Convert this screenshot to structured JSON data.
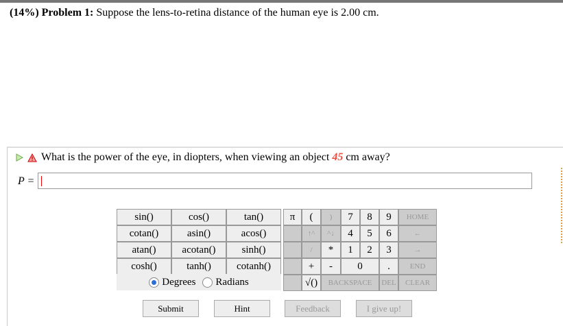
{
  "problem": {
    "percent": "(14%)",
    "label": "Problem 1:",
    "text": "Suppose the lens-to-retina distance of the human eye is 2.00 cm."
  },
  "question": {
    "before": "What is the power of the eye, in diopters, when viewing an object",
    "value": "45",
    "after": "cm away?"
  },
  "answer": {
    "label": "P =",
    "value": ""
  },
  "functions": [
    [
      "sin()",
      "cos()",
      "tan()"
    ],
    [
      "cotan()",
      "asin()",
      "acos()"
    ],
    [
      "atan()",
      "acotan()",
      "sinh()"
    ],
    [
      "cosh()",
      "tanh()",
      "cotanh()"
    ]
  ],
  "keypad": {
    "pi": "π",
    "lparen": "(",
    "rparen": ")",
    "up": "↑^",
    "down": "^↓",
    "div": "/",
    "mul": "*",
    "plus": "+",
    "minus": "-",
    "sqrt": "√()",
    "digits": [
      "7",
      "8",
      "9",
      "4",
      "5",
      "6",
      "1",
      "2",
      "3",
      "0"
    ],
    "dot": ".",
    "home": "HOME",
    "left": "←",
    "right": "→",
    "end": "END",
    "backspace": "BACKSPACE",
    "del": "DEL",
    "clear": "CLEAR"
  },
  "angle": {
    "degrees": "Degrees",
    "radians": "Radians",
    "selected": "Degrees"
  },
  "buttons": {
    "submit": "Submit",
    "hint": "Hint",
    "feedback": "Feedback",
    "giveup": "I give up!"
  }
}
